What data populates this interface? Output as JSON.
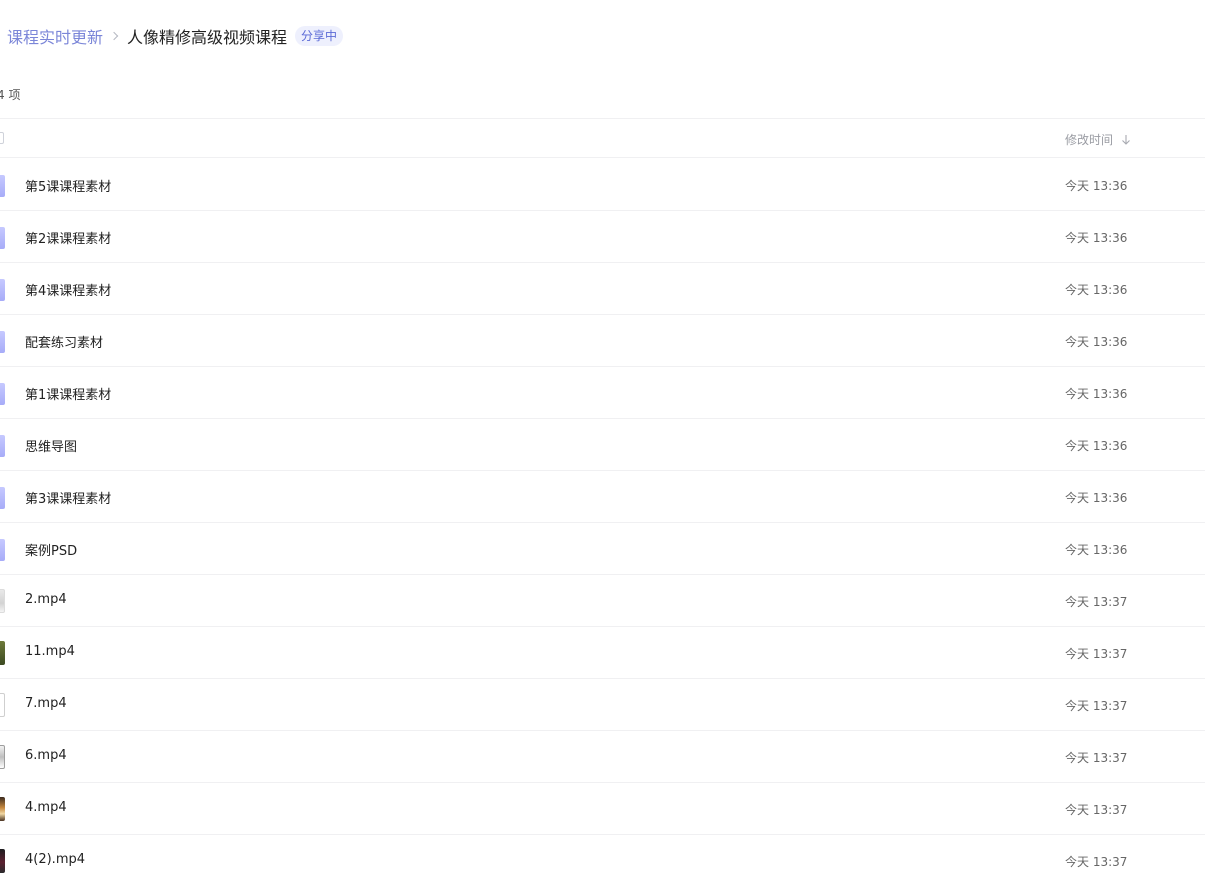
{
  "breadcrumb": {
    "parent": "课程实时更新",
    "current": "人像精修高级视频课程",
    "badge": "分享中"
  },
  "summary": {
    "count_text": "4 项"
  },
  "header": {
    "modified_label": "修改时间"
  },
  "files": [
    {
      "name": "第5课课程素材",
      "time": "今天 13:36",
      "icon": "folder-icon",
      "kind": "folder"
    },
    {
      "name": "第2课课程素材",
      "time": "今天 13:36",
      "icon": "folder-icon",
      "kind": "folder"
    },
    {
      "name": "第4课课程素材",
      "time": "今天 13:36",
      "icon": "folder-icon",
      "kind": "folder"
    },
    {
      "name": "配套练习素材",
      "time": "今天 13:36",
      "icon": "folder-icon",
      "kind": "folder"
    },
    {
      "name": "第1课课程素材",
      "time": "今天 13:36",
      "icon": "folder-icon",
      "kind": "folder"
    },
    {
      "name": "思维导图",
      "time": "今天 13:36",
      "icon": "folder-icon",
      "kind": "folder"
    },
    {
      "name": "第3课课程素材",
      "time": "今天 13:36",
      "icon": "folder-icon",
      "kind": "folder"
    },
    {
      "name": "案例PSD",
      "time": "今天 13:36",
      "icon": "folder-icon",
      "kind": "folder"
    },
    {
      "name": "2.mp4",
      "time": "今天 13:37",
      "icon": "video-thumbnail-icon",
      "kind": "thumb-light"
    },
    {
      "name": "11.mp4",
      "time": "今天 13:37",
      "icon": "video-thumbnail-icon",
      "kind": "thumb-green"
    },
    {
      "name": "7.mp4",
      "time": "今天 13:37",
      "icon": "video-thumbnail-icon",
      "kind": "thumb-white"
    },
    {
      "name": "6.mp4",
      "time": "今天 13:37",
      "icon": "video-thumbnail-icon",
      "kind": "thumb-grey"
    },
    {
      "name": "4.mp4",
      "time": "今天 13:37",
      "icon": "video-thumbnail-icon",
      "kind": "thumb-warm"
    },
    {
      "name": "4(2).mp4",
      "time": "今天 13:37",
      "icon": "video-thumbnail-icon",
      "kind": "thumb-dark"
    }
  ]
}
